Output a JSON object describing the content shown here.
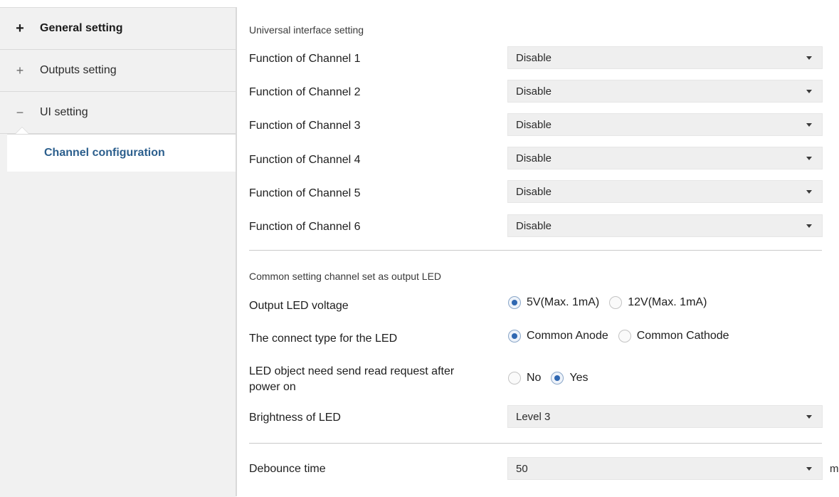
{
  "sidebar": {
    "items": [
      {
        "icon": "plus-icon",
        "symbol": "+",
        "label": "General setting"
      },
      {
        "icon": "plus-icon",
        "symbol": "+",
        "label": "Outputs setting"
      },
      {
        "icon": "minus-icon",
        "symbol": "−",
        "label": "UI setting"
      }
    ],
    "active_item": {
      "label": "Channel configuration"
    }
  },
  "main": {
    "section1_title": "Universal interface setting",
    "channels": [
      {
        "label": "Function of Channel 1",
        "value": "Disable"
      },
      {
        "label": "Function of Channel 2",
        "value": "Disable"
      },
      {
        "label": "Function of Channel 3",
        "value": "Disable"
      },
      {
        "label": "Function of Channel 4",
        "value": "Disable"
      },
      {
        "label": "Function of Channel 5",
        "value": "Disable"
      },
      {
        "label": "Function of Channel 6",
        "value": "Disable"
      }
    ],
    "section2_title": "Common setting channel set as output LED",
    "output_led_voltage": {
      "label": "Output LED voltage",
      "options": [
        "5V(Max. 1mA)",
        "12V(Max. 1mA)"
      ],
      "selected": "5V(Max. 1mA)"
    },
    "connect_type": {
      "label": "The connect type for the LED",
      "options": [
        "Common Anode",
        "Common Cathode"
      ],
      "selected": "Common Anode"
    },
    "read_request": {
      "label_line1": "LED object need send read request after",
      "label_line2": "power on",
      "options": [
        "No",
        "Yes"
      ],
      "selected": "Yes"
    },
    "brightness": {
      "label": "Brightness of LED",
      "value": "Level 3"
    },
    "debounce": {
      "label": "Debounce time",
      "value": "50",
      "unit": "ms"
    }
  },
  "colors": {
    "sidebar_bg": "#f1f1f1",
    "active_text": "#2c5f8d",
    "dropdown_bg": "#efefef",
    "radio_dot": "#2f67b1"
  }
}
